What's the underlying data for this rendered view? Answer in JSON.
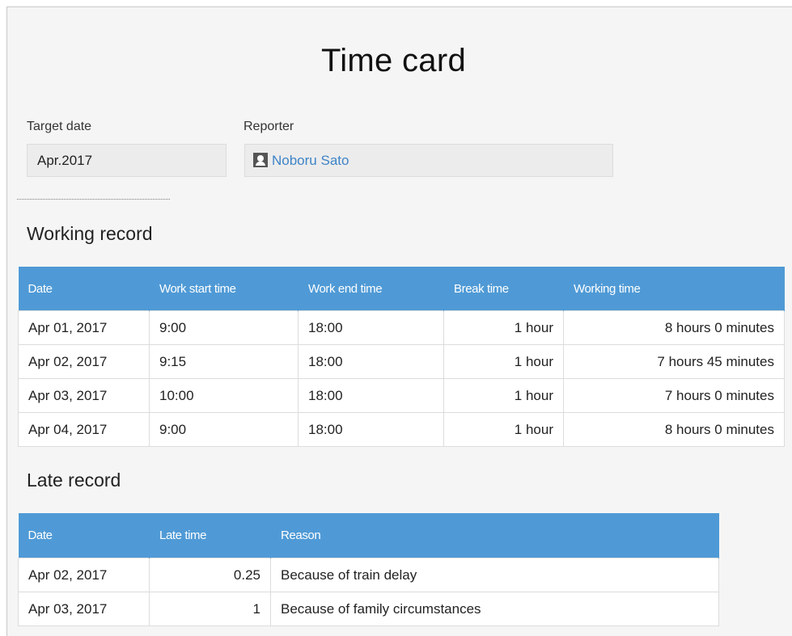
{
  "title": "Time card",
  "target_date": {
    "label": "Target date",
    "value": "Apr.2017"
  },
  "reporter": {
    "label": "Reporter",
    "name": "Noboru Sato",
    "icon": "user-icon"
  },
  "working_record": {
    "heading": "Working record",
    "columns": [
      "Date",
      "Work start time",
      "Work end time",
      "Break time",
      "Working time"
    ],
    "rows": [
      [
        "Apr 01, 2017",
        "9:00",
        "18:00",
        "1 hour",
        "8 hours 0 minutes"
      ],
      [
        "Apr 02, 2017",
        "9:15",
        "18:00",
        "1 hour",
        "7 hours 45 minutes"
      ],
      [
        "Apr 03, 2017",
        "10:00",
        "18:00",
        "1 hour",
        "7 hours 0 minutes"
      ],
      [
        "Apr 04, 2017",
        "9:00",
        "18:00",
        "1 hour",
        "8 hours 0 minutes"
      ]
    ]
  },
  "late_record": {
    "heading": "Late record",
    "columns": [
      "Date",
      "Late time",
      "Reason"
    ],
    "rows": [
      [
        "Apr 02, 2017",
        "0.25",
        "Because of train delay"
      ],
      [
        "Apr 03, 2017",
        "1",
        "Because of family circumstances"
      ]
    ]
  },
  "colors": {
    "header_blue": "#4f9ad6",
    "link_blue": "#3e84c7",
    "page_bg": "#f5f5f5"
  }
}
